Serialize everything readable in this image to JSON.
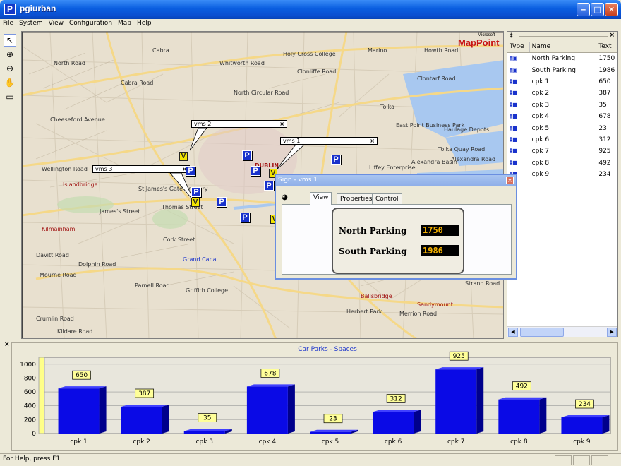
{
  "window": {
    "title": "pgiurban",
    "app_icon": "P"
  },
  "menu": [
    "File",
    "System",
    "View",
    "Configuration",
    "Map",
    "Help"
  ],
  "map": {
    "brand": "MapPoint",
    "brand_small": "Microsoft",
    "labels": [
      "Cabra",
      "Holy Cross College",
      "Marino",
      "Howth Road",
      "North Road",
      "Cabra Road",
      "Whitworth Road",
      "Clonliffe Road",
      "Clontarf Road",
      "North Circular Road",
      "Cheeseford Avenue",
      "Tolka",
      "East Point Business Park",
      "Haulage Depots",
      "Tolka Quay Road",
      "Alexandra Road",
      "Alexandra Basin",
      "Liffey Enterprise",
      "DUBLIN",
      "Islandbridge",
      "St James's Gate Brewery",
      "Thomas Street",
      "James's Street",
      "Kilmainham",
      "Davitt Road",
      "Mourne Road",
      "Parnell Road",
      "Grand Canal",
      "Griffith College",
      "Crumlin Road",
      "Kildare Road",
      "Sandymount",
      "Ballsbridge",
      "Herbert Park",
      "Merrion Road",
      "Cork Street",
      "Dolphin Road",
      "Wellington Road",
      "Strand Road"
    ],
    "callouts": [
      {
        "id": "vms2",
        "label": "vms 2",
        "close": "×"
      },
      {
        "id": "vms1",
        "label": "vms 1",
        "close": "×"
      },
      {
        "id": "vms3",
        "label": "vms 3",
        "close": "×"
      }
    ],
    "parking_marker_text": "P",
    "vms_marker_text": "V"
  },
  "sidebar": {
    "close": "×",
    "columns": [
      "Type",
      "Name",
      "Text"
    ],
    "rows": [
      {
        "type": "vms",
        "name": "North Parking",
        "text": "1750"
      },
      {
        "type": "vms",
        "name": "South Parking",
        "text": "1986"
      },
      {
        "type": "cpk",
        "name": "cpk 1",
        "text": "650"
      },
      {
        "type": "cpk",
        "name": "cpk 2",
        "text": "387"
      },
      {
        "type": "cpk",
        "name": "cpk 3",
        "text": "35"
      },
      {
        "type": "cpk",
        "name": "cpk 4",
        "text": "678"
      },
      {
        "type": "cpk",
        "name": "cpk 5",
        "text": "23"
      },
      {
        "type": "cpk",
        "name": "cpk 6",
        "text": "312"
      },
      {
        "type": "cpk",
        "name": "cpk 7",
        "text": "925"
      },
      {
        "type": "cpk",
        "name": "cpk 8",
        "text": "492"
      },
      {
        "type": "cpk",
        "name": "cpk 9",
        "text": "234"
      }
    ]
  },
  "dialog": {
    "title": "Sign - vms 1",
    "close": "×",
    "tabs": [
      "View",
      "Properties",
      "Control"
    ],
    "active_tab": "View",
    "sign": [
      {
        "label": "North Parking",
        "value": "1750"
      },
      {
        "label": "South Parking",
        "value": "1986"
      }
    ]
  },
  "chart_data": {
    "type": "bar",
    "title": "Car Parks - Spaces",
    "categories": [
      "cpk 1",
      "cpk 2",
      "cpk 3",
      "cpk 4",
      "cpk 5",
      "cpk 6",
      "cpk 7",
      "cpk 8",
      "cpk 9"
    ],
    "values": [
      650,
      387,
      35,
      678,
      23,
      312,
      925,
      492,
      234
    ],
    "ylim": [
      0,
      1100
    ],
    "yticks": [
      0,
      200,
      400,
      600,
      800,
      1000
    ],
    "grid": true,
    "bar_color": "#0a0ae6",
    "label_bg": "#ffff99"
  },
  "status": {
    "text": "For Help, press F1"
  },
  "colors": {
    "titlebar": "#0a5ee0",
    "parking_marker": "#1932cc",
    "vms_marker": "#f2e400",
    "map_bg": "#e8e0cf",
    "water": "#a8c8f0"
  }
}
